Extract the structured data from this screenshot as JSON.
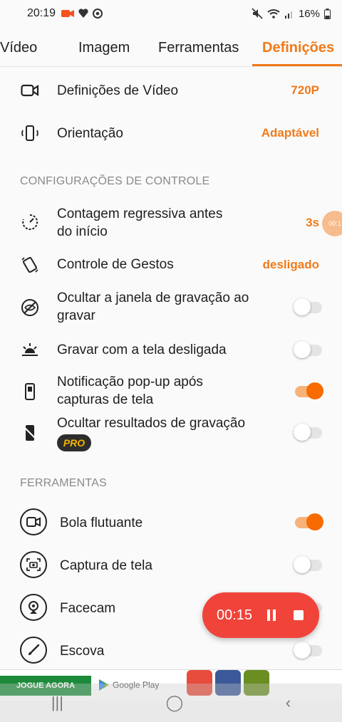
{
  "status_bar": {
    "time": "20:19",
    "battery": "16%",
    "left_icons": [
      "video-camera-icon",
      "heart-icon",
      "chrome-icon"
    ],
    "right_icons": [
      "mute-icon",
      "wifi-icon",
      "signal-icon",
      "battery-icon"
    ]
  },
  "tabs": [
    {
      "label": "Vídeo",
      "active": false
    },
    {
      "label": "Imagem",
      "active": false
    },
    {
      "label": "Ferramentas",
      "active": false
    },
    {
      "label": "Definições",
      "active": true
    }
  ],
  "video_settings": {
    "label": "Definições de Vídeo",
    "value": "720P",
    "icon": "video-camera-icon"
  },
  "orientation": {
    "label": "Orientação",
    "value": "Adaptável",
    "icon": "phone-rotate-icon"
  },
  "control_section": {
    "title": "CONFIGURAÇÕES DE CONTROLE",
    "countdown": {
      "label_line1": "Contagem regressiva antes",
      "label_line2": "do início",
      "value": "3s",
      "icon": "timer-icon"
    },
    "gestures": {
      "label": "Controle de Gestos",
      "value": "desligado",
      "icon": "gesture-icon"
    },
    "hide_window": {
      "label_line1": "Ocultar a janela de gravação ao",
      "label_line2": "gravar",
      "enabled": false,
      "icon": "hidden-eye-icon"
    },
    "screen_off": {
      "label": "Gravar com a tela desligada",
      "enabled": false,
      "icon": "sunset-icon"
    },
    "popup": {
      "label_line1": "Notificação pop-up após",
      "label_line2": "capturas de tela",
      "enabled": true,
      "icon": "phone-notification-icon"
    },
    "hide_results": {
      "label": "Ocultar resultados de gravação",
      "badge": "PRO",
      "enabled": false,
      "icon": "phone-hidden-icon"
    }
  },
  "tools_section": {
    "title": "FERRAMENTAS",
    "items": [
      {
        "label": "Bola flutuante",
        "enabled": true,
        "icon": "video-camera-icon"
      },
      {
        "label": "Captura de tela",
        "enabled": false,
        "icon": "screenshot-camera-icon"
      },
      {
        "label": "Facecam",
        "enabled": false,
        "icon": "webcam-icon"
      },
      {
        "label": "Escova",
        "enabled": false,
        "icon": "brush-icon"
      }
    ]
  },
  "floating_bubble": {
    "text": "00:1"
  },
  "recording": {
    "time": "00:15"
  },
  "ad": {
    "button": "JOGUE AGORA",
    "store": "Google Play"
  },
  "navbar": {
    "recents": "|||",
    "home": "◯",
    "back": "‹"
  },
  "colors": {
    "accent": "#f07a1a",
    "record_red": "#f0443a"
  }
}
